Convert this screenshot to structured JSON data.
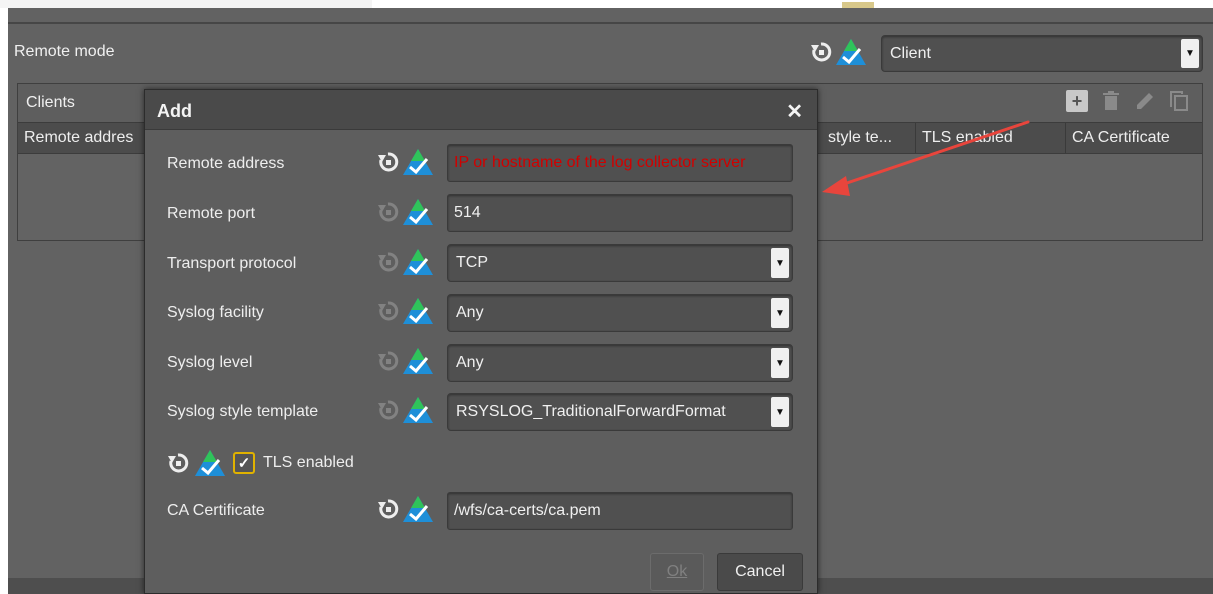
{
  "remote_mode": {
    "label": "Remote mode",
    "value": "Client"
  },
  "clients": {
    "title": "Clients",
    "toolbar": {
      "add_icon": "plus-icon",
      "delete_icon": "trash-icon",
      "edit_icon": "pencil-icon",
      "copy_icon": "copy-icon"
    },
    "columns": [
      "Remote addres",
      "style te...",
      "TLS enabled",
      "CA Certificate"
    ]
  },
  "dialog": {
    "title": "Add",
    "close_glyph": "✕",
    "remote_address": {
      "label": "Remote address",
      "placeholder": "IP or hostname of the log collector server"
    },
    "remote_port": {
      "label": "Remote port",
      "value": "514"
    },
    "transport_protocol": {
      "label": "Transport protocol",
      "value": "TCP"
    },
    "syslog_facility": {
      "label": "Syslog facility",
      "value": "Any"
    },
    "syslog_level": {
      "label": "Syslog level",
      "value": "Any"
    },
    "syslog_style_template": {
      "label": "Syslog style template",
      "value": "RSYSLOG_TraditionalForwardFormat"
    },
    "tls": {
      "label": "TLS enabled",
      "checked": true,
      "check_glyph": "✓"
    },
    "ca_certificate": {
      "label": "CA Certificate",
      "value": "/wfs/ca-certs/ca.pem"
    },
    "ok_label": "Ok",
    "cancel_label": "Cancel"
  },
  "colors": {
    "arrow": "#e8453c",
    "placeholder": "#d10000",
    "checkbox_border": "#e0b200"
  }
}
